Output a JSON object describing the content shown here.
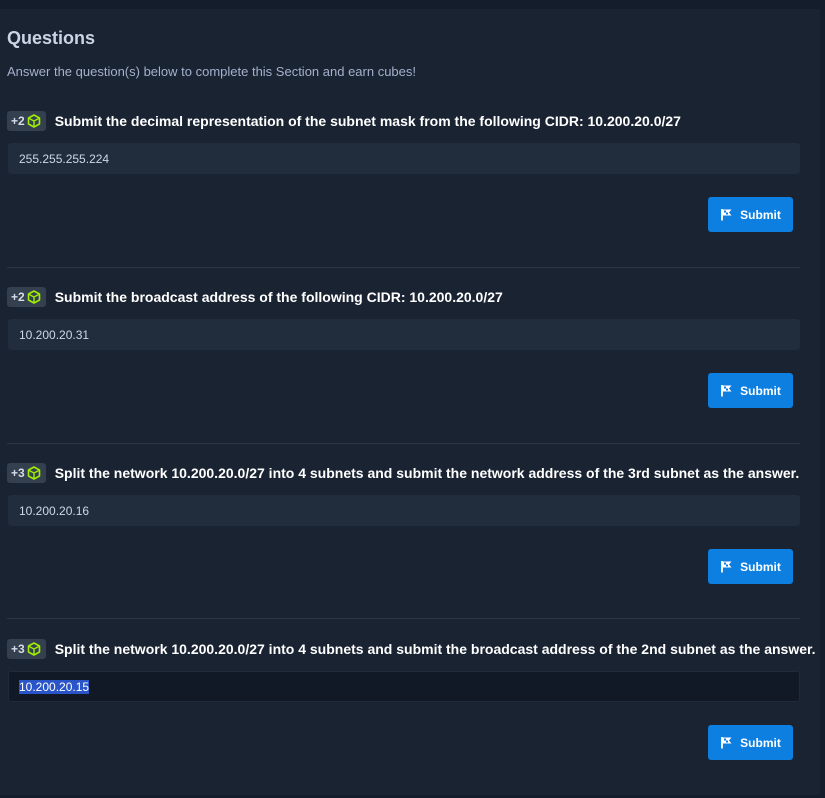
{
  "header": {
    "title": "Questions",
    "subtitle": "Answer the question(s) below to complete this Section and earn cubes!"
  },
  "questions": [
    {
      "points": "+2",
      "text": "Submit the decimal representation of the subnet mask from the following CIDR: 10.200.20.0/27",
      "answer": "255.255.255.224",
      "submit_label": "Submit"
    },
    {
      "points": "+2",
      "text": "Submit the broadcast address of the following CIDR: 10.200.20.0/27",
      "answer": "10.200.20.31",
      "submit_label": "Submit"
    },
    {
      "points": "+3",
      "text": "Split the network 10.200.20.0/27 into 4 subnets and submit the network address of the 3rd subnet as the answer.",
      "answer": "10.200.20.16",
      "submit_label": "Submit"
    },
    {
      "points": "+3",
      "text": "Split the network 10.200.20.0/27 into 4 subnets and submit the broadcast address of the 2nd subnet as the answer.",
      "answer": "10.200.20.15",
      "submit_label": "Submit"
    }
  ],
  "icons": {
    "cube": "cube-icon",
    "flag": "flag-icon"
  },
  "colors": {
    "background": "#1a2332",
    "accent_green": "#9fef00",
    "button_blue": "#0d7fe0",
    "selection": "#2a55c9"
  }
}
